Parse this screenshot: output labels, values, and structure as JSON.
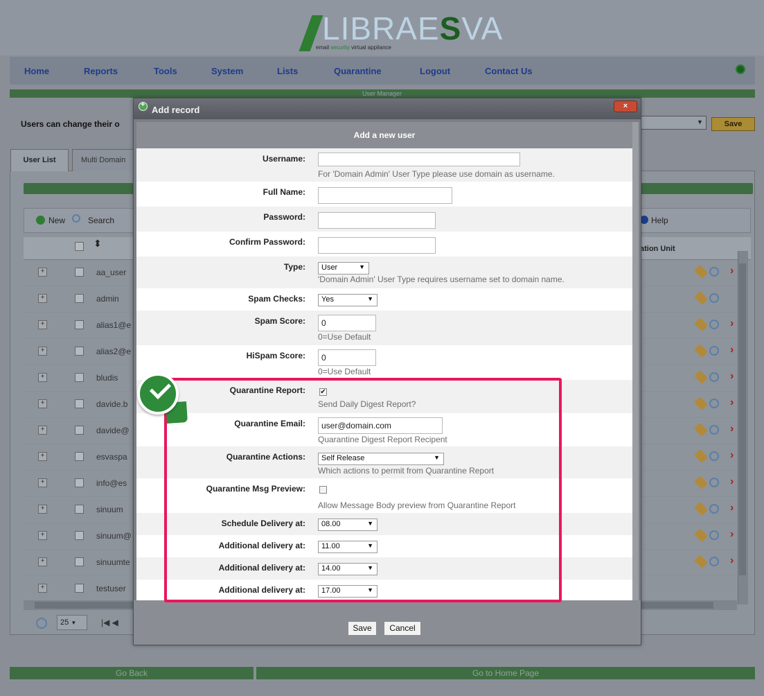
{
  "app": {
    "logo_text": "LIBRAESVA",
    "logo_prefix": "LIBRAE",
    "logo_bold": "S",
    "logo_suffix": "VA",
    "logo_sub_1": "email",
    "logo_sub_2": "security",
    "logo_sub_3": "virtual appliance"
  },
  "nav": {
    "items": [
      "Home",
      "Reports",
      "Tools",
      "System",
      "Lists",
      "Quarantine",
      "Logout",
      "Contact Us"
    ]
  },
  "page": {
    "section_title": "User Manager",
    "users_change_label": "Users can change their o",
    "save_label": "Save",
    "tabs": [
      "User List",
      "Multi Domain"
    ],
    "toolbar": {
      "new": "New",
      "search": "Search",
      "help": "Help"
    },
    "column_org_unit": "ation Unit",
    "rows": [
      "aa_user",
      "admin",
      "alias1@e",
      "alias2@e",
      "bludis",
      "davide.b",
      "davide@",
      "esvaspa",
      "info@es",
      "sinuum",
      "sinuum@",
      "sinuumte",
      "testuser"
    ],
    "pager_size": "25",
    "pager_first": "|◀ ◀",
    "go_back": "Go Back",
    "go_home": "Go to Home Page"
  },
  "dialog": {
    "title": "Add record",
    "close": "×",
    "form_header": "Add a new user",
    "fields": {
      "username_label": "Username:",
      "username_hint": "For 'Domain Admin' User Type please use domain as username.",
      "fullname_label": "Full Name:",
      "password_label": "Password:",
      "confirm_label": "Confirm Password:",
      "type_label": "Type:",
      "type_value": "User",
      "type_hint": "'Domain Admin' User Type requires username set to domain name.",
      "spam_checks_label": "Spam Checks:",
      "spam_checks_value": "Yes",
      "spam_score_label": "Spam Score:",
      "spam_score_value": "0",
      "spam_score_hint": "0=Use Default",
      "hispam_label": "HiSpam Score:",
      "hispam_value": "0",
      "hispam_hint": "0=Use Default",
      "qreport_label": "Quarantine Report:",
      "qreport_hint": "Send Daily Digest Report?",
      "qemail_label": "Quarantine Email:",
      "qemail_value": "user@domain.com",
      "qemail_hint": "Quarantine Digest Report Recipent",
      "qactions_label": "Quarantine Actions:",
      "qactions_value": "Self Release",
      "qactions_hint": "Which actions to permit from Quarantine Report",
      "qpreview_label": "Quarantine Msg Preview:",
      "qpreview_hint": "Allow Message Body preview from Quarantine Report",
      "sched_label": "Schedule Delivery at:",
      "sched_value": "08.00",
      "add1_label": "Additional delivery at:",
      "add1_value": "11.00",
      "add2_label": "Additional delivery at:",
      "add2_value": "14.00",
      "add3_label": "Additional delivery at:",
      "add3_value": "17.00"
    },
    "save": "Save",
    "cancel": "Cancel"
  },
  "colors": {
    "highlight": "#e8175d",
    "badge": "#2e8b3a",
    "brand_green": "#1b5e20"
  }
}
